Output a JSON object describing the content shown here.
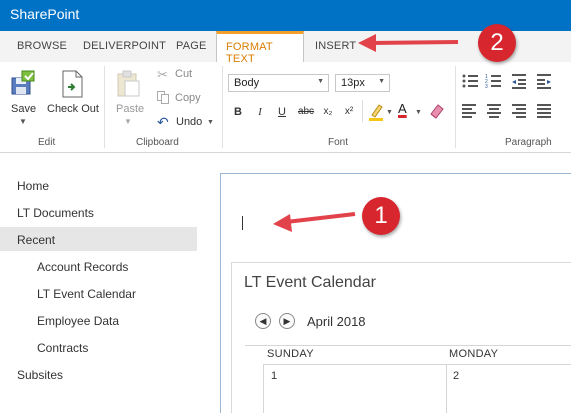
{
  "app": {
    "title": "SharePoint"
  },
  "tabs": [
    {
      "label": "BROWSE"
    },
    {
      "label": "DELIVERPOINT"
    },
    {
      "label": "PAGE"
    },
    {
      "label": "FORMAT TEXT"
    },
    {
      "label": "INSERT"
    }
  ],
  "ribbon": {
    "edit": {
      "save": "Save",
      "checkout": "Check Out",
      "group": "Edit"
    },
    "clipboard": {
      "paste": "Paste",
      "cut": "Cut",
      "copy": "Copy",
      "undo": "Undo",
      "group": "Clipboard"
    },
    "font": {
      "family": "Body",
      "size": "13px",
      "bold": "B",
      "italic": "I",
      "underline": "U",
      "strike": "abc",
      "subscript": "x₂",
      "superscript": "x²",
      "font_color": "A",
      "group": "Font"
    },
    "paragraph": {
      "group": "Paragraph"
    }
  },
  "nav": {
    "items": [
      {
        "label": "Home"
      },
      {
        "label": "LT Documents"
      },
      {
        "label": "Recent"
      },
      {
        "label": "Account Records"
      },
      {
        "label": "LT Event Calendar"
      },
      {
        "label": "Employee Data"
      },
      {
        "label": "Contracts"
      },
      {
        "label": "Subsites"
      }
    ]
  },
  "calendar": {
    "title": "LT Event Calendar",
    "month": "April 2018",
    "days": [
      "SUNDAY",
      "MONDAY"
    ],
    "dates": [
      "1",
      "2"
    ]
  },
  "callouts": {
    "one": "1",
    "two": "2"
  },
  "colors": {
    "brand": "#0072c6",
    "active_tab": "#d97c00",
    "callout": "#d7262d"
  }
}
